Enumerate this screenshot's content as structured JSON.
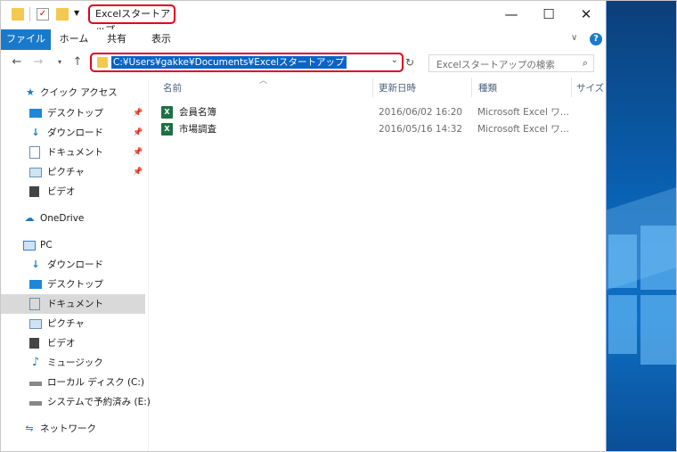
{
  "titlebar": {
    "title": "Excelスタートアップ",
    "minimize": "—",
    "maximize": "☐",
    "close": "✕"
  },
  "ribbon": {
    "tabs": [
      "ファイル",
      "ホーム",
      "共有",
      "表示"
    ],
    "help": "?",
    "expand": "∨"
  },
  "address": {
    "path": "C:¥Users¥gakke¥Documents¥Excelスタートアップ",
    "search_placeholder": "Excelスタートアップの検索"
  },
  "nav": {
    "quick_access": "クイック アクセス",
    "quick_items": [
      {
        "label": "デスクトップ",
        "icon": "desktop-icon"
      },
      {
        "label": "ダウンロード",
        "icon": "download-icon"
      },
      {
        "label": "ドキュメント",
        "icon": "document-icon"
      },
      {
        "label": "ピクチャ",
        "icon": "picture-icon"
      },
      {
        "label": "ビデオ",
        "icon": "video-icon"
      }
    ],
    "onedrive": "OneDrive",
    "pc": "PC",
    "pc_items": [
      {
        "label": "ダウンロード",
        "icon": "download-icon"
      },
      {
        "label": "デスクトップ",
        "icon": "desktop-icon"
      },
      {
        "label": "ドキュメント",
        "icon": "document-icon",
        "selected": true
      },
      {
        "label": "ピクチャ",
        "icon": "picture-icon"
      },
      {
        "label": "ビデオ",
        "icon": "video-icon"
      },
      {
        "label": "ミュージック",
        "icon": "music-icon"
      },
      {
        "label": "ローカル ディスク (C:)",
        "icon": "disk-icon"
      },
      {
        "label": "システムで予約済み (E:)",
        "icon": "disk-icon"
      }
    ],
    "network": "ネットワーク"
  },
  "columns": [
    "名前",
    "更新日時",
    "種類",
    "サイズ"
  ],
  "files": [
    {
      "name": "会員名簿",
      "modified": "2016/06/02 16:20",
      "type": "Microsoft Excel ワ..."
    },
    {
      "name": "市場調査",
      "modified": "2016/05/16 14:32",
      "type": "Microsoft Excel ワ..."
    }
  ],
  "colors": {
    "accent": "#1979ca",
    "highlight": "#e0001b",
    "selection": "#0a64c8"
  }
}
